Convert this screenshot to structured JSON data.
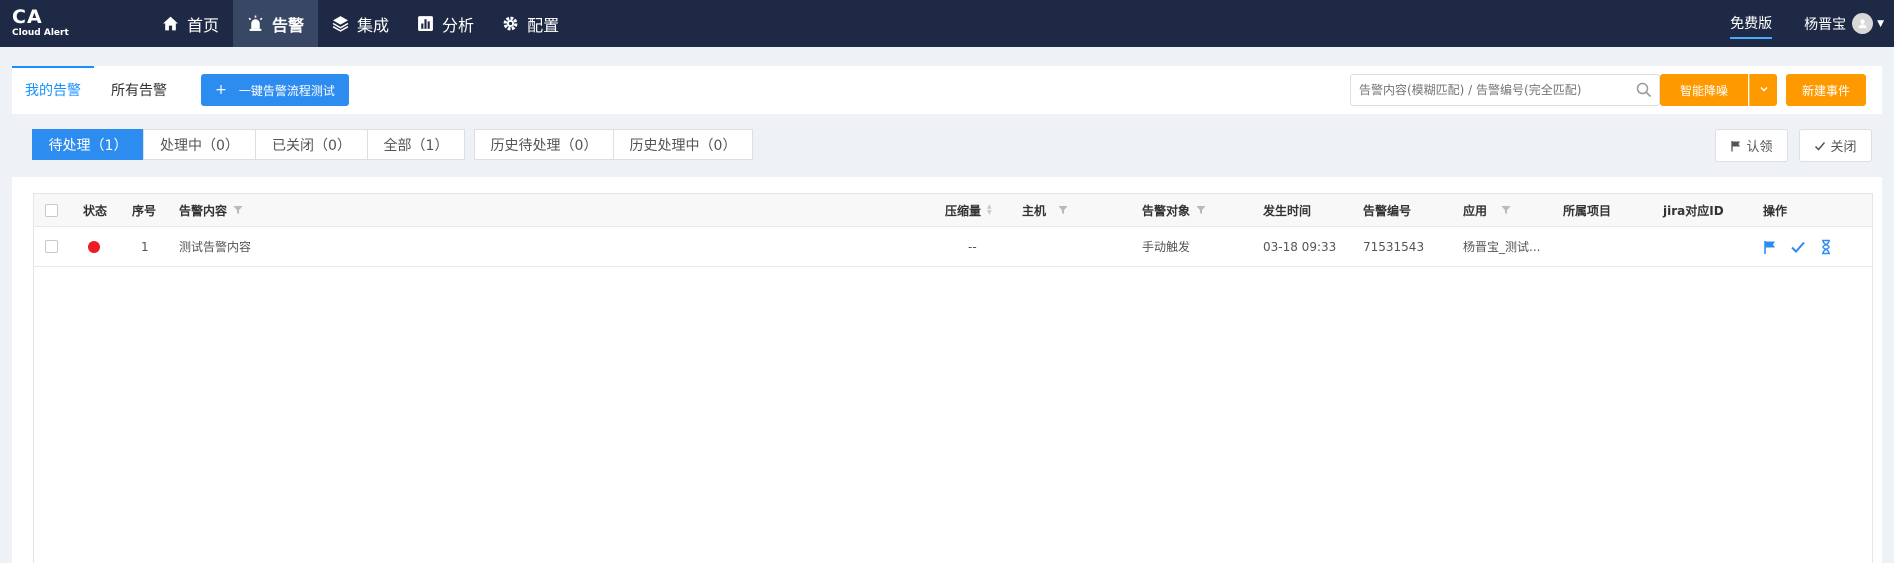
{
  "app": {
    "logo_main": "CA",
    "logo_sub": "Cloud Alert"
  },
  "nav": [
    {
      "label": "首页",
      "icon": "home-icon",
      "active": false
    },
    {
      "label": "告警",
      "icon": "alarm-icon",
      "active": true
    },
    {
      "label": "集成",
      "icon": "layers-icon",
      "active": false
    },
    {
      "label": "分析",
      "icon": "chart-icon",
      "active": false
    },
    {
      "label": "配置",
      "icon": "gear-icon",
      "active": false
    }
  ],
  "topright": {
    "edition": "免费版",
    "user": "杨晋宝"
  },
  "tabs": {
    "mine": "我的告警",
    "all": "所有告警"
  },
  "toolbar": {
    "test_button": "一键告警流程测试",
    "search_placeholder": "告警内容(模糊匹配) / 告警编号(完全匹配)",
    "smart_button": "智能降噪",
    "new_button": "新建事件"
  },
  "filters": {
    "pending": "待处理（1）",
    "processing": "处理中（0）",
    "closed": "已关闭（0）",
    "all": "全部（1）",
    "hist_pending": "历史待处理（0）",
    "hist_processing": "历史处理中（0）"
  },
  "actions": {
    "ack": "认领",
    "close": "关闭"
  },
  "table": {
    "headers": {
      "status": "状态",
      "index": "序号",
      "content": "告警内容",
      "compress": "压缩量",
      "host": "主机",
      "target": "告警对象",
      "time": "发生时间",
      "number": "告警编号",
      "app": "应用",
      "project": "所属项目",
      "jira": "jira对应ID",
      "ops": "操作"
    },
    "rows": [
      {
        "status_color": "#ed1c24",
        "index": "1",
        "content": "测试告警内容",
        "compress": "--",
        "host": "",
        "target": "手动触发",
        "time": "03-18 09:33",
        "number": "71531543",
        "app": "杨晋宝_测试...",
        "project": "",
        "jira": ""
      }
    ]
  },
  "colors": {
    "nav_bg": "#1e2a45",
    "primary": "#2d8cf0",
    "orange": "#ff9900",
    "status_red": "#ed1c24"
  }
}
